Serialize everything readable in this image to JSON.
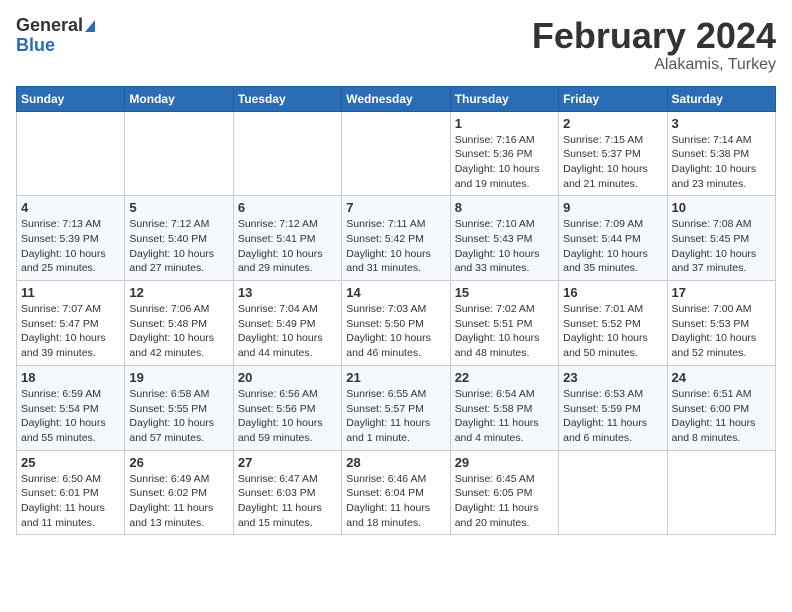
{
  "header": {
    "logo_general": "General",
    "logo_blue": "Blue",
    "month": "February 2024",
    "location": "Alakamis, Turkey"
  },
  "weekdays": [
    "Sunday",
    "Monday",
    "Tuesday",
    "Wednesday",
    "Thursday",
    "Friday",
    "Saturday"
  ],
  "weeks": [
    [
      {
        "day": "",
        "sunrise": "",
        "sunset": "",
        "daylight": ""
      },
      {
        "day": "",
        "sunrise": "",
        "sunset": "",
        "daylight": ""
      },
      {
        "day": "",
        "sunrise": "",
        "sunset": "",
        "daylight": ""
      },
      {
        "day": "",
        "sunrise": "",
        "sunset": "",
        "daylight": ""
      },
      {
        "day": "1",
        "sunrise": "Sunrise: 7:16 AM",
        "sunset": "Sunset: 5:36 PM",
        "daylight": "Daylight: 10 hours and 19 minutes."
      },
      {
        "day": "2",
        "sunrise": "Sunrise: 7:15 AM",
        "sunset": "Sunset: 5:37 PM",
        "daylight": "Daylight: 10 hours and 21 minutes."
      },
      {
        "day": "3",
        "sunrise": "Sunrise: 7:14 AM",
        "sunset": "Sunset: 5:38 PM",
        "daylight": "Daylight: 10 hours and 23 minutes."
      }
    ],
    [
      {
        "day": "4",
        "sunrise": "Sunrise: 7:13 AM",
        "sunset": "Sunset: 5:39 PM",
        "daylight": "Daylight: 10 hours and 25 minutes."
      },
      {
        "day": "5",
        "sunrise": "Sunrise: 7:12 AM",
        "sunset": "Sunset: 5:40 PM",
        "daylight": "Daylight: 10 hours and 27 minutes."
      },
      {
        "day": "6",
        "sunrise": "Sunrise: 7:12 AM",
        "sunset": "Sunset: 5:41 PM",
        "daylight": "Daylight: 10 hours and 29 minutes."
      },
      {
        "day": "7",
        "sunrise": "Sunrise: 7:11 AM",
        "sunset": "Sunset: 5:42 PM",
        "daylight": "Daylight: 10 hours and 31 minutes."
      },
      {
        "day": "8",
        "sunrise": "Sunrise: 7:10 AM",
        "sunset": "Sunset: 5:43 PM",
        "daylight": "Daylight: 10 hours and 33 minutes."
      },
      {
        "day": "9",
        "sunrise": "Sunrise: 7:09 AM",
        "sunset": "Sunset: 5:44 PM",
        "daylight": "Daylight: 10 hours and 35 minutes."
      },
      {
        "day": "10",
        "sunrise": "Sunrise: 7:08 AM",
        "sunset": "Sunset: 5:45 PM",
        "daylight": "Daylight: 10 hours and 37 minutes."
      }
    ],
    [
      {
        "day": "11",
        "sunrise": "Sunrise: 7:07 AM",
        "sunset": "Sunset: 5:47 PM",
        "daylight": "Daylight: 10 hours and 39 minutes."
      },
      {
        "day": "12",
        "sunrise": "Sunrise: 7:06 AM",
        "sunset": "Sunset: 5:48 PM",
        "daylight": "Daylight: 10 hours and 42 minutes."
      },
      {
        "day": "13",
        "sunrise": "Sunrise: 7:04 AM",
        "sunset": "Sunset: 5:49 PM",
        "daylight": "Daylight: 10 hours and 44 minutes."
      },
      {
        "day": "14",
        "sunrise": "Sunrise: 7:03 AM",
        "sunset": "Sunset: 5:50 PM",
        "daylight": "Daylight: 10 hours and 46 minutes."
      },
      {
        "day": "15",
        "sunrise": "Sunrise: 7:02 AM",
        "sunset": "Sunset: 5:51 PM",
        "daylight": "Daylight: 10 hours and 48 minutes."
      },
      {
        "day": "16",
        "sunrise": "Sunrise: 7:01 AM",
        "sunset": "Sunset: 5:52 PM",
        "daylight": "Daylight: 10 hours and 50 minutes."
      },
      {
        "day": "17",
        "sunrise": "Sunrise: 7:00 AM",
        "sunset": "Sunset: 5:53 PM",
        "daylight": "Daylight: 10 hours and 52 minutes."
      }
    ],
    [
      {
        "day": "18",
        "sunrise": "Sunrise: 6:59 AM",
        "sunset": "Sunset: 5:54 PM",
        "daylight": "Daylight: 10 hours and 55 minutes."
      },
      {
        "day": "19",
        "sunrise": "Sunrise: 6:58 AM",
        "sunset": "Sunset: 5:55 PM",
        "daylight": "Daylight: 10 hours and 57 minutes."
      },
      {
        "day": "20",
        "sunrise": "Sunrise: 6:56 AM",
        "sunset": "Sunset: 5:56 PM",
        "daylight": "Daylight: 10 hours and 59 minutes."
      },
      {
        "day": "21",
        "sunrise": "Sunrise: 6:55 AM",
        "sunset": "Sunset: 5:57 PM",
        "daylight": "Daylight: 11 hours and 1 minute."
      },
      {
        "day": "22",
        "sunrise": "Sunrise: 6:54 AM",
        "sunset": "Sunset: 5:58 PM",
        "daylight": "Daylight: 11 hours and 4 minutes."
      },
      {
        "day": "23",
        "sunrise": "Sunrise: 6:53 AM",
        "sunset": "Sunset: 5:59 PM",
        "daylight": "Daylight: 11 hours and 6 minutes."
      },
      {
        "day": "24",
        "sunrise": "Sunrise: 6:51 AM",
        "sunset": "Sunset: 6:00 PM",
        "daylight": "Daylight: 11 hours and 8 minutes."
      }
    ],
    [
      {
        "day": "25",
        "sunrise": "Sunrise: 6:50 AM",
        "sunset": "Sunset: 6:01 PM",
        "daylight": "Daylight: 11 hours and 11 minutes."
      },
      {
        "day": "26",
        "sunrise": "Sunrise: 6:49 AM",
        "sunset": "Sunset: 6:02 PM",
        "daylight": "Daylight: 11 hours and 13 minutes."
      },
      {
        "day": "27",
        "sunrise": "Sunrise: 6:47 AM",
        "sunset": "Sunset: 6:03 PM",
        "daylight": "Daylight: 11 hours and 15 minutes."
      },
      {
        "day": "28",
        "sunrise": "Sunrise: 6:46 AM",
        "sunset": "Sunset: 6:04 PM",
        "daylight": "Daylight: 11 hours and 18 minutes."
      },
      {
        "day": "29",
        "sunrise": "Sunrise: 6:45 AM",
        "sunset": "Sunset: 6:05 PM",
        "daylight": "Daylight: 11 hours and 20 minutes."
      },
      {
        "day": "",
        "sunrise": "",
        "sunset": "",
        "daylight": ""
      },
      {
        "day": "",
        "sunrise": "",
        "sunset": "",
        "daylight": ""
      }
    ]
  ]
}
